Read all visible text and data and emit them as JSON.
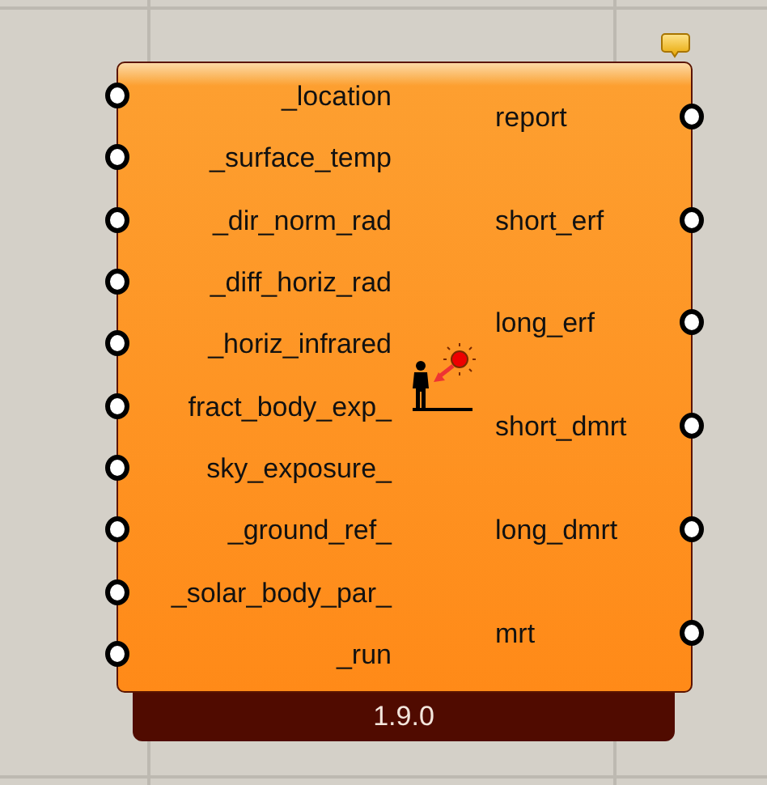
{
  "component": {
    "inputs": [
      "_location",
      "_surface_temp",
      "_dir_norm_rad",
      "_diff_horiz_rad",
      "_horiz_infrared",
      "fract_body_exp_",
      "sky_exposure_",
      "_ground_ref_",
      "_solar_body_par_",
      "_run"
    ],
    "outputs": [
      "report",
      "short_erf",
      "long_erf",
      "short_dmrt",
      "long_dmrt",
      "mrt"
    ],
    "version": "1.9.0"
  }
}
